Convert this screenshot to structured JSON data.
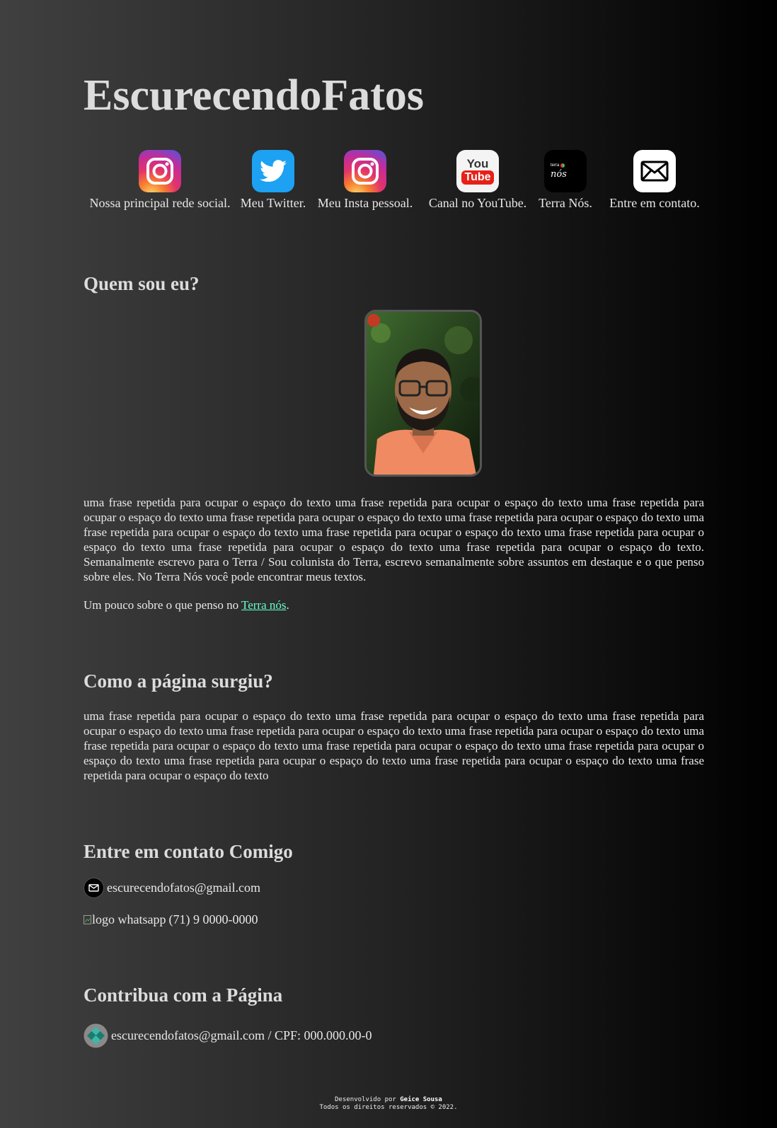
{
  "header": {
    "title": "EscurecendoFatos"
  },
  "socials": [
    {
      "label": "Nossa principal rede social.",
      "icon": "instagram-icon"
    },
    {
      "label": "Meu Twitter.",
      "icon": "twitter-icon"
    },
    {
      "label": "Meu Insta pessoal.",
      "icon": "instagram-icon"
    },
    {
      "label": "Canal no YouTube.",
      "icon": "youtube-icon",
      "icon_text_top": "You",
      "icon_text_bottom": "Tube"
    },
    {
      "label": "Terra Nós.",
      "icon": "terra-nos-icon",
      "icon_text_top": "terra",
      "icon_text_bottom": "nós"
    },
    {
      "label": "Entre em contato.",
      "icon": "mail-icon"
    }
  ],
  "about": {
    "heading": "Quem sou eu?",
    "paragraph": "uma frase repetida para ocupar o espaço do texto uma frase repetida para ocupar o espaço do texto uma frase repetida para ocupar o espaço do texto uma frase repetida para ocupar o espaço do texto uma frase repetida para ocupar o espaço do texto uma frase repetida para ocupar o espaço do texto uma frase repetida para ocupar o espaço do texto uma frase repetida para ocupar o espaço do texto uma frase repetida para ocupar o espaço do texto uma frase repetida para ocupar o espaço do texto. Semanalmente escrevo para o Terra / Sou colunista do Terra, escrevo semanalmente sobre assuntos em destaque e o que penso sobre eles. No Terra Nós você pode encontrar meus textos.",
    "more_prefix": "Um pouco sobre o que penso no ",
    "more_link": "Terra nós",
    "more_suffix": "."
  },
  "origin": {
    "heading": "Como a página surgiu?",
    "paragraph": "uma frase repetida para ocupar o espaço do texto uma frase repetida para ocupar o espaço do texto uma frase repetida para ocupar o espaço do texto uma frase repetida para ocupar o espaço do texto uma frase repetida para ocupar o espaço do texto uma frase repetida para ocupar o espaço do texto uma frase repetida para ocupar o espaço do texto uma frase repetida para ocupar o espaço do texto uma frase repetida para ocupar o espaço do texto uma frase repetida para ocupar o espaço do texto uma frase repetida para ocupar o espaço do texto"
  },
  "contact": {
    "heading": "Entre em contato Comigo",
    "email": "escurecendofatos@gmail.com",
    "whatsapp_alt": "logo whatsapp",
    "whatsapp_number": "(71) 9 0000-0000"
  },
  "contribute": {
    "heading": "Contribua com a Página",
    "pix": "escurecendofatos@gmail.com / CPF: 000.000.00-0",
    "icon": "pix-icon"
  },
  "footer": {
    "line1_prefix": "Desenvolvido por ",
    "line1_author": "Geice Sousa",
    "line2": "Todos os direitos reservados © 2022."
  },
  "colors": {
    "link": "#66ffcc",
    "twitter": "#1da1f2",
    "youtube_red": "#e62117"
  }
}
